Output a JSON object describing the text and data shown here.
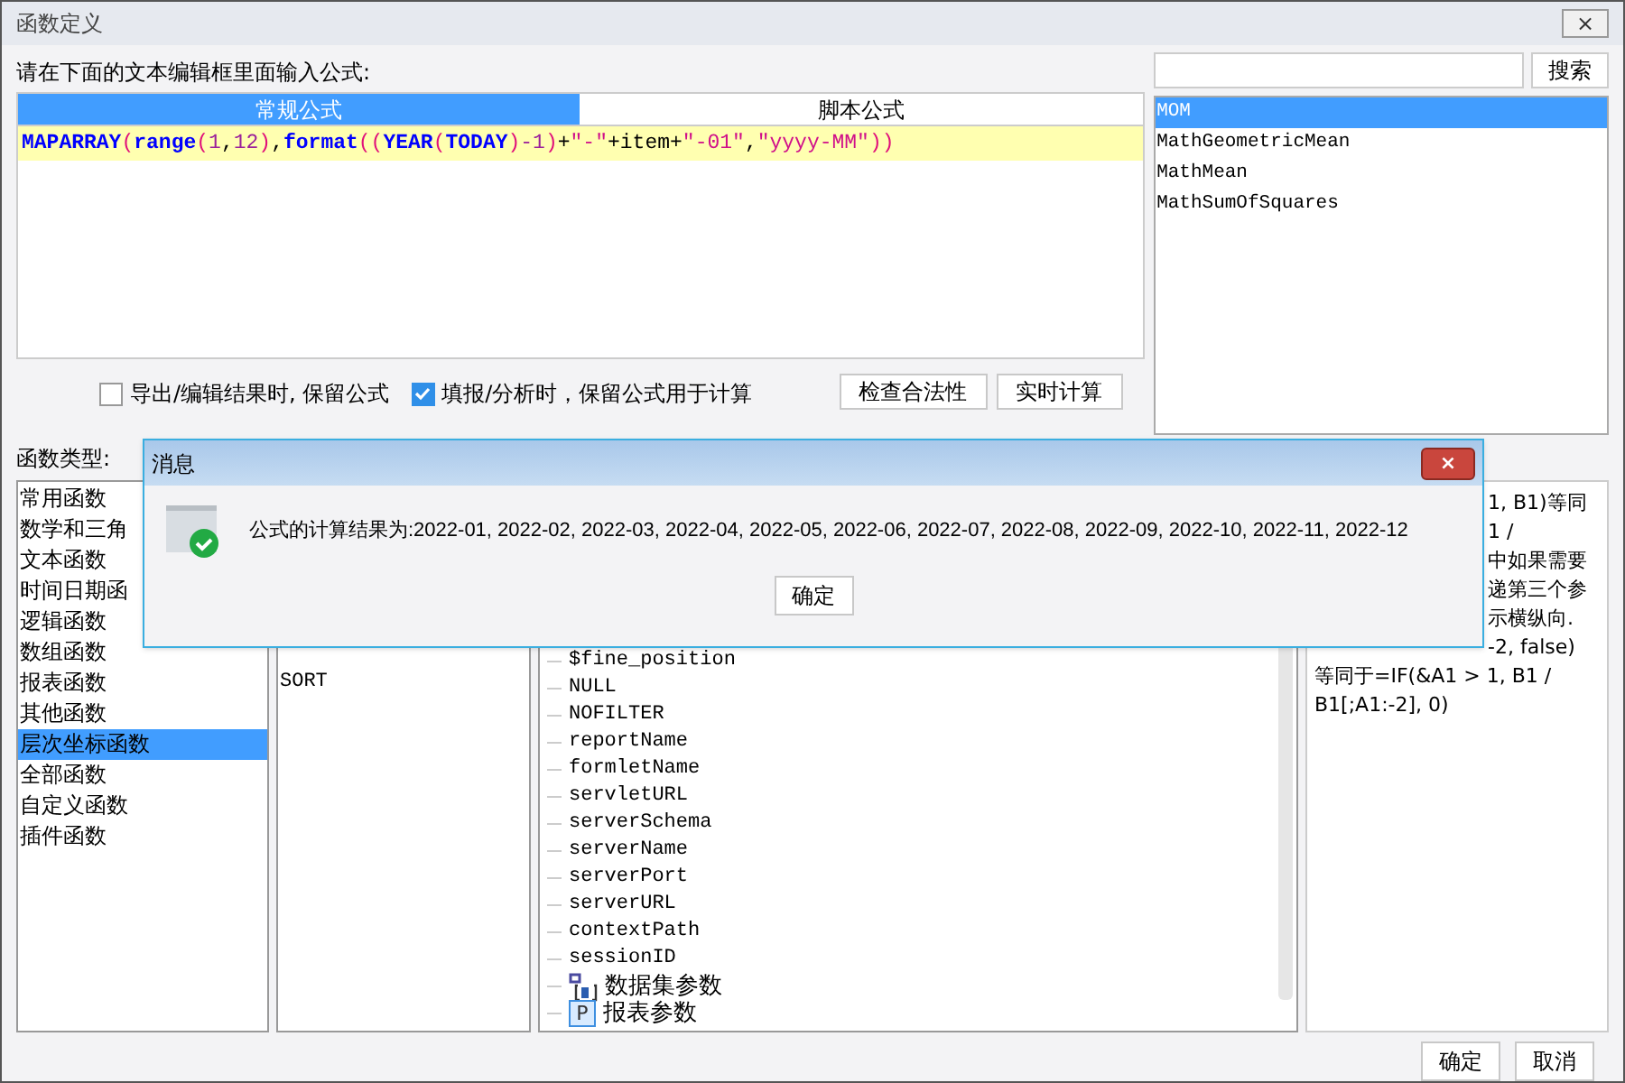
{
  "window": {
    "title": "函数定义",
    "close": "×"
  },
  "prompt": "请在下面的文本编辑框里面输入公式:",
  "tabs": [
    {
      "label": "常规公式",
      "selected": true
    },
    {
      "label": "脚本公式",
      "selected": false
    }
  ],
  "formula": [
    {
      "text": "MAPARRAY",
      "kind": "func"
    },
    {
      "text": "(",
      "kind": "paren"
    },
    {
      "text": "range",
      "kind": "func"
    },
    {
      "text": "(",
      "kind": "paren"
    },
    {
      "text": "1",
      "kind": "num"
    },
    {
      "text": ",",
      "kind": "plain"
    },
    {
      "text": "12",
      "kind": "num"
    },
    {
      "text": ")",
      "kind": "paren"
    },
    {
      "text": ",",
      "kind": "plain"
    },
    {
      "text": "format",
      "kind": "func"
    },
    {
      "text": "((",
      "kind": "paren"
    },
    {
      "text": "YEAR",
      "kind": "func"
    },
    {
      "text": "(",
      "kind": "paren"
    },
    {
      "text": "TODAY",
      "kind": "func"
    },
    {
      "text": ")",
      "kind": "paren"
    },
    {
      "text": "-1",
      "kind": "num"
    },
    {
      "text": ")",
      "kind": "paren"
    },
    {
      "text": "+",
      "kind": "plain"
    },
    {
      "text": "\"-\"",
      "kind": "string"
    },
    {
      "text": "+item+",
      "kind": "plain"
    },
    {
      "text": "\"-01\"",
      "kind": "string"
    },
    {
      "text": ",",
      "kind": "plain"
    },
    {
      "text": "\"yyyy-MM\"",
      "kind": "string"
    },
    {
      "text": "))",
      "kind": "paren"
    }
  ],
  "search": {
    "button": "搜索"
  },
  "functions": [
    {
      "label": "MOM",
      "selected": true
    },
    {
      "label": "MathGeometricMean",
      "selected": false
    },
    {
      "label": "MathMean",
      "selected": false
    },
    {
      "label": "MathSumOfSquares",
      "selected": false
    }
  ],
  "options": [
    {
      "label": "导出/编辑结果时, 保留公式",
      "checked": false
    },
    {
      "label": "填报/分析时，保留公式用于计算",
      "checked": true
    }
  ],
  "actions": [
    "检查合法性",
    "实时计算"
  ],
  "category_label": "函数类型:",
  "categories": [
    {
      "label": "常用函数",
      "selected": false
    },
    {
      "label": "数学和三角",
      "selected": false
    },
    {
      "label": "文本函数",
      "selected": false
    },
    {
      "label": "时间日期函",
      "selected": false
    },
    {
      "label": "逻辑函数",
      "selected": false
    },
    {
      "label": "数组函数",
      "selected": false
    },
    {
      "label": "报表函数",
      "selected": false
    },
    {
      "label": "其他函数",
      "selected": false
    },
    {
      "label": "层次坐标函数",
      "selected": true
    },
    {
      "label": "全部函数",
      "selected": false
    },
    {
      "label": "自定义函数",
      "selected": false
    },
    {
      "label": "插件函数",
      "selected": false
    }
  ],
  "function_names": [
    "SORT"
  ],
  "tree": [
    {
      "children": [
        {
          "label": "$fine_position"
        },
        {
          "label": "NULL"
        },
        {
          "label": "NOFILTER"
        },
        {
          "label": "reportName"
        },
        {
          "label": "formletName"
        },
        {
          "label": "servletURL"
        },
        {
          "label": "serverSchema"
        },
        {
          "label": "serverName"
        },
        {
          "label": "serverPort"
        },
        {
          "label": "serverURL"
        },
        {
          "label": "contextPath"
        },
        {
          "label": "sessionID"
        }
      ]
    },
    {
      "label": "数据集参数",
      "kind": "dataset"
    },
    {
      "label": "报表参数",
      "kind": "param",
      "icon_text": "P"
    }
  ],
  "description": [
    {
      "text": "1, B1)等同",
      "kind": "partial"
    },
    {
      "text": "1 /",
      "kind": "partial"
    },
    {
      "text": "中如果需要",
      "kind": "partial"
    },
    {
      "text": "递第三个参",
      "kind": "partial"
    },
    {
      "text": "示横纵向.",
      "kind": "partial"
    },
    {
      "text": "-2, false)",
      "kind": "partial"
    },
    {
      "text": "等同于=IF(&A1 > 1, B1 /",
      "kind": "full"
    },
    {
      "text": "B1[;A1:-2], 0)",
      "kind": "full"
    }
  ],
  "buttons": [
    "确定",
    "取消"
  ],
  "message": {
    "title": "消息",
    "text": "公式的计算结果为:2022-01, 2022-02, 2022-03, 2022-04, 2022-05, 2022-06, 2022-07, 2022-08, 2022-09, 2022-10, 2022-11, 2022-12",
    "button": "确定"
  }
}
